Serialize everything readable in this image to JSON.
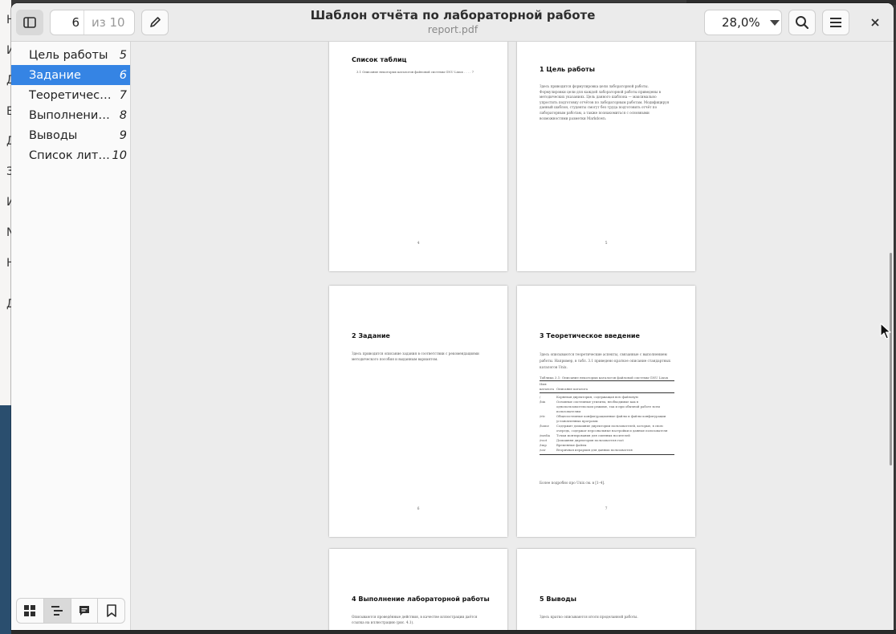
{
  "desktop": {
    "left_letters": [
      "Н",
      "И",
      "Д",
      "Е",
      "Д",
      "З",
      "И",
      "N",
      "Н",
      "Д"
    ]
  },
  "header": {
    "title": "Шаблон отчёта по лабораторной работе",
    "subtitle": "report.pdf",
    "page_current": "6",
    "page_total": "из 10",
    "zoom": "28,0%"
  },
  "sidebar": {
    "outline": [
      {
        "label": "Цель работы",
        "page": "5"
      },
      {
        "label": "Задание",
        "page": "6",
        "selected": true
      },
      {
        "label": "Теоретическое введение",
        "page": "7"
      },
      {
        "label": "Выполнение лабораторной работы",
        "page": "8"
      },
      {
        "label": "Выводы",
        "page": "9"
      },
      {
        "label": "Список литературы",
        "page": "10"
      }
    ],
    "tabs": [
      "thumbnails-icon",
      "outline-icon",
      "annotations-icon",
      "bookmarks-icon"
    ]
  },
  "pages": {
    "p4": {
      "heading": "Список таблиц",
      "entry": "3.1  Описание некоторых каталогов файловой системы GNU Linux . . . . 7",
      "num": "4"
    },
    "p5": {
      "heading": "1  Цель работы",
      "text": "Здесь приводится формулировка цели лабораторной работы. Формулировки цели для каждой лабораторной работы приведены в методических указаниях. Цель данного шаблона — максимально упростить подготовку отчётов по лабораторным работам. Модифицируя данный шаблон, студенты смогут без труда подготовить отчёт по лабораторным работам, а также познакомиться с основными возможностями разметки Markdown.",
      "num": "5"
    },
    "p6": {
      "heading": "2  Задание",
      "text": "Здесь приводится описание задания в соответствии с рекомендациями методического пособия и выданным вариантом.",
      "num": "6"
    },
    "p7": {
      "heading": "3  Теоретическое введение",
      "text": "Здесь описываются теоретические аспекты, связанные с выполнением работы. Например, в табл. 3.1 приведено краткое описание стандартных каталогов Unix.",
      "caption": "Таблица 3.1: Описание некоторых каталогов файловой системы GNU Linux",
      "col1": "Имя каталога",
      "col2": "Описание каталога",
      "rows": [
        {
          "dir": "/",
          "desc": "Корневая директория, содержащая всю файловую"
        },
        {
          "dir": "/bin",
          "desc": "Основные системные утилиты, необходимые как в однопользовательском режиме, так и при обычной работе всем пользователям"
        },
        {
          "dir": "/etc",
          "desc": "Общесистемные конфигурационные файлы и файлы конфигурации установленных программ"
        },
        {
          "dir": "/home",
          "desc": "Содержит домашние директории пользователей, которые, в свою очередь, содержат персональные настройки и данные пользователя"
        },
        {
          "dir": "/media",
          "desc": "Точки монтирования для сменных носителей"
        },
        {
          "dir": "/root",
          "desc": "Домашняя директория пользователя root"
        },
        {
          "dir": "/tmp",
          "desc": "Временные файлы"
        },
        {
          "dir": "/usr",
          "desc": "Вторичная иерархия для данных пользователя"
        }
      ],
      "after": "Более подробно про Unix см. в [1–4].",
      "num": "7"
    },
    "p8": {
      "heading": "4  Выполнение лабораторной работы",
      "text": "Описываются проведённые действия, в качестве иллюстрации даётся ссылка на иллюстрацию (рис. 4.1)."
    },
    "p9": {
      "heading": "5  Выводы",
      "text": "Здесь кратко описываются итоги проделанной работы."
    }
  }
}
